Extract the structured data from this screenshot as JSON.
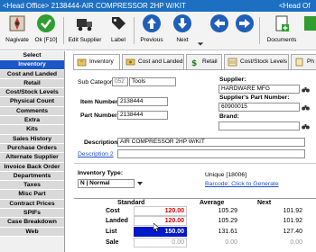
{
  "window": {
    "title": "<Head Office> 2138444-AIR COMPRESSOR 2HP W/KIT",
    "title_right": "<Head Of"
  },
  "toolbar": {
    "navigate": "Nagivate",
    "ok": "Ok [F10]",
    "edit_supplier": "Edit Supplier",
    "label": "Label",
    "previous": "Previous",
    "next": "Next",
    "documents": "Documents"
  },
  "sidebar": {
    "header": "Select",
    "items": [
      "Inventory",
      "Cost and Landed",
      "Retail",
      "Cost/Stock Levels",
      "Physical Count",
      "Comments",
      "Extra",
      "Kits",
      "Sales History",
      "Purchase Orders",
      "Alternate Supplier",
      "Invoice Back Order",
      "Departments",
      "Taxes",
      "Misc Part",
      "Contract Prices",
      "SPIFs",
      "Case Breakdown",
      "Web"
    ],
    "active_index": 0
  },
  "tabs": [
    "Inventory",
    "Cost and Landed",
    "Retail",
    "Cost/Stock Levels",
    "Ph"
  ],
  "form": {
    "sub_category_label": "Sub Category",
    "sub_category_code": "052",
    "sub_category_value": "Tools",
    "supplier_label": "Supplier:",
    "supplier_value": "HARDWARE MFG",
    "item_number_label": "Item Number",
    "item_number_value": "2138444",
    "suppliers_part_label": "Supplier's Part Number:",
    "suppliers_part_value": "60900015",
    "part_number_label": "Part Number",
    "part_number_value": "2138444",
    "brand_label": "Brand:",
    "brand_value": "",
    "description_label": "Description",
    "description_value": "AIR COMPRESSOR 2HP W/KIT",
    "description2_label": "Description 2",
    "description2_value": "",
    "inventory_type_label": "Inventory Type:",
    "inventory_type_value": "N | Normal",
    "unique_label": "Unique [18006]",
    "barcode_link": "Barcode: Click to Generate"
  },
  "pricing": {
    "columns": [
      "Standard",
      "Average",
      "Next"
    ],
    "rows": [
      {
        "label": "Cost",
        "standard": "120.00",
        "average": "105.29",
        "next": "101.92"
      },
      {
        "label": "Landed",
        "standard": "120.00",
        "average": "105.29",
        "next": "101.92"
      },
      {
        "label": "List",
        "standard": "150.00",
        "average": "131.61",
        "next": "127.40"
      },
      {
        "label": "Sale",
        "standard": "0.00",
        "average": "0.00",
        "next": "0.00"
      }
    ]
  },
  "colors": {
    "title_bar": "#1d6fc2",
    "selected_sidebar": "#1b57c9",
    "cost_red": "#d40000",
    "selected_cell": "#0019c9"
  }
}
